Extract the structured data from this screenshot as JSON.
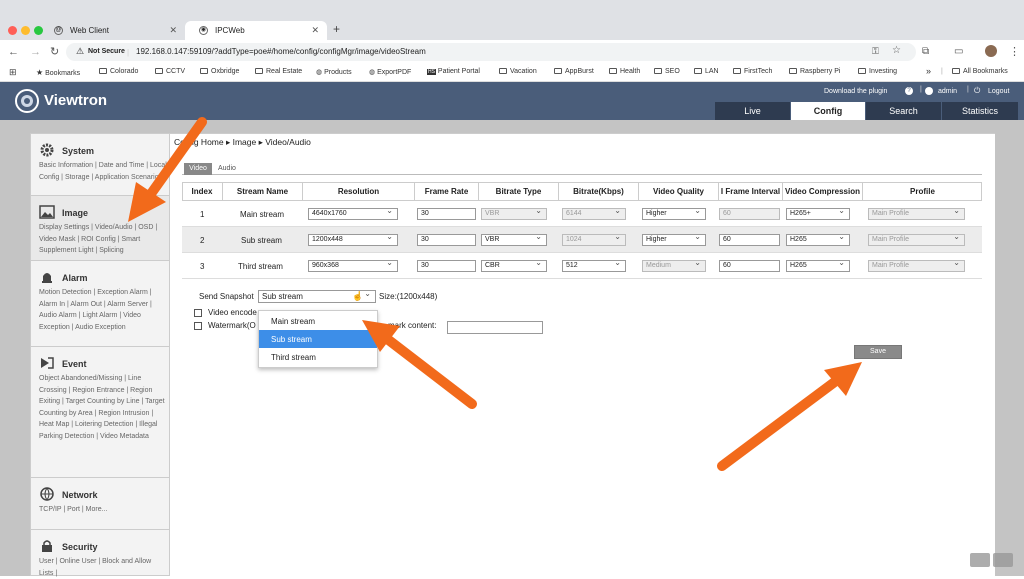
{
  "browser": {
    "tabs": [
      {
        "title": "Web Client"
      },
      {
        "title": "IPCWeb"
      }
    ],
    "new_tab": "+",
    "security_label": "Not Secure",
    "url": "192.168.0.147:59109/?addType=poe#/home/config/configMgr/image/videoStream",
    "bookmarks": [
      "Bookmarks",
      "Colorado",
      "CCTV",
      "Oxbridge",
      "Real Estate",
      "Products",
      "ExportPDF",
      "Patient Portal",
      "Vacation",
      "AppBurst",
      "Health",
      "SEO",
      "LAN",
      "FirstTech",
      "Raspberry Pi",
      "Investing"
    ],
    "bookmarks_overflow": "»",
    "all_bookmarks": "All Bookmarks"
  },
  "app": {
    "logo": "Viewtron",
    "download_plugin": "Download the plugin",
    "user": "admin",
    "logout": "Logout",
    "nav": [
      "Live",
      "Config",
      "Search",
      "Statistics"
    ],
    "active_nav": "Config"
  },
  "sidebar": {
    "sections": [
      {
        "title": "System",
        "links": "Basic Information | Date and Time | Local Config | Storage | Application Scenarios"
      },
      {
        "title": "Image",
        "links": "Display Settings | Video/Audio | OSD | Video Mask | ROI Config | Smart Supplement Light | Splicing"
      },
      {
        "title": "Alarm",
        "links": "Motion Detection | Exception Alarm | Alarm In | Alarm Out | Alarm Server | Audio Alarm | Light Alarm | Video Exception | Audio Exception"
      },
      {
        "title": "Event",
        "links": "Object Abandoned/Missing | Line Crossing | Region Entrance | Region Exiting | Target Counting by Line | Target Counting by Area | Region Intrusion | Heat Map | Loitering Detection | Illegal Parking Detection | Video Metadata"
      },
      {
        "title": "Network",
        "links": "TCP/IP | Port | More..."
      },
      {
        "title": "Security",
        "links": "User | Online User | Block and Allow Lists |"
      }
    ]
  },
  "main": {
    "breadcrumb": "Config Home ▸ Image ▸ Video/Audio",
    "subtabs": [
      "Video",
      "Audio"
    ],
    "columns": [
      "Index",
      "Stream Name",
      "Resolution",
      "Frame Rate",
      "Bitrate Type",
      "Bitrate(Kbps)",
      "Video Quality",
      "I Frame Interval",
      "Video Compression",
      "Profile"
    ],
    "rows": [
      {
        "index": "1",
        "name": "Main stream",
        "resolution": "4640x1760",
        "frame_rate": "30",
        "bitrate_type": "VBR",
        "bitrate": "6144",
        "quality": "Higher",
        "iframe": "60",
        "compression": "H265+",
        "profile": "Main Profile"
      },
      {
        "index": "2",
        "name": "Sub stream",
        "resolution": "1200x448",
        "frame_rate": "30",
        "bitrate_type": "VBR",
        "bitrate": "1024",
        "quality": "Higher",
        "iframe": "60",
        "compression": "H265",
        "profile": "Main Profile"
      },
      {
        "index": "3",
        "name": "Third stream",
        "resolution": "960x368",
        "frame_rate": "30",
        "bitrate_type": "CBR",
        "bitrate": "512",
        "quality": "Medium",
        "iframe": "60",
        "compression": "H265",
        "profile": "Main Profile"
      }
    ],
    "snapshot_label": "Send Snapshot",
    "snapshot_value": "Sub stream",
    "snapshot_size": "Size:(1200x448)",
    "video_encode_label": "Video encode",
    "watermark_label": "Watermark(O",
    "watermark_content_label": "mark content:",
    "dropdown_options": [
      "Main stream",
      "Sub stream",
      "Third stream"
    ],
    "dropdown_selected": "Sub stream",
    "save": "Save"
  },
  "colors": {
    "header": "#4a5d7a",
    "arrow": "#f26a1b",
    "dropdown_highlight": "#3d8ee8"
  }
}
